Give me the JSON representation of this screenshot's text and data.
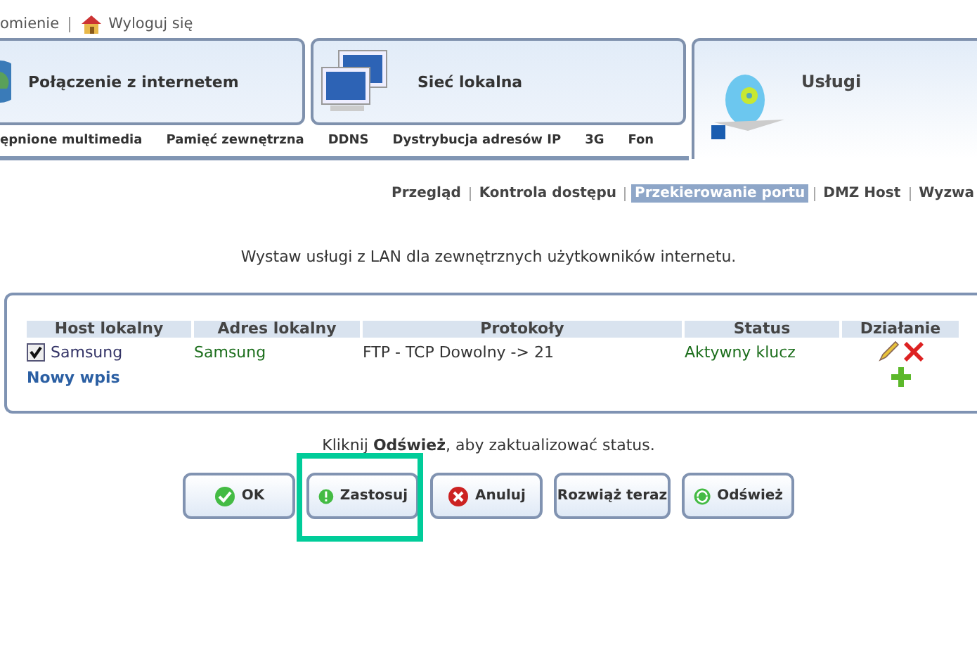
{
  "top_links": [
    {
      "label": "omienie"
    },
    {
      "label": "Wyloguj się"
    }
  ],
  "main_tabs": [
    {
      "label": "Połączenie z internetem",
      "kind": "globe",
      "selected": false
    },
    {
      "label": "Sieć lokalna",
      "kind": "network",
      "selected": false
    },
    {
      "label": "Usługi",
      "kind": "disc",
      "selected": true
    }
  ],
  "sub_tabs": [
    {
      "label": "ępnione multimedia"
    },
    {
      "label": "Pamięć zewnętrzna"
    },
    {
      "label": "DDNS"
    },
    {
      "label": "Dystrybucja adresów IP"
    },
    {
      "label": "3G"
    },
    {
      "label": "Fon"
    }
  ],
  "section_tabs": [
    {
      "label": "Przegląd",
      "selected": false
    },
    {
      "label": "Kontrola dostępu",
      "selected": false
    },
    {
      "label": "Przekierowanie portu",
      "selected": true
    },
    {
      "label": "DMZ Host",
      "selected": false
    },
    {
      "label": "Wyzwa",
      "selected": false
    }
  ],
  "description": "Wystaw usługi z LAN dla zewnętrznych użytkowników internetu.",
  "table": {
    "columns": [
      "Host lokalny",
      "Adres lokalny",
      "Protokoły",
      "Status",
      "Działanie"
    ],
    "rows": [
      {
        "checked": true,
        "host": "Samsung",
        "address": "Samsung",
        "protocols": "FTP - TCP Dowolny -> 21",
        "status": "Aktywny klucz"
      }
    ],
    "new_entry": "Nowy wpis"
  },
  "note": "Kliknij **Odśwież**, aby zaktualizować status.",
  "buttons": [
    {
      "label": "OK",
      "kind": "ok",
      "highlighted": false
    },
    {
      "label": "Zastosuj",
      "kind": "apply",
      "highlighted": true
    },
    {
      "label": "Anuluj",
      "kind": "cancel",
      "highlighted": false
    },
    {
      "label": "Rozwiąż teraz",
      "kind": "plain",
      "highlighted": false
    },
    {
      "label": "Odśwież",
      "kind": "refresh",
      "highlighted": false
    }
  ]
}
